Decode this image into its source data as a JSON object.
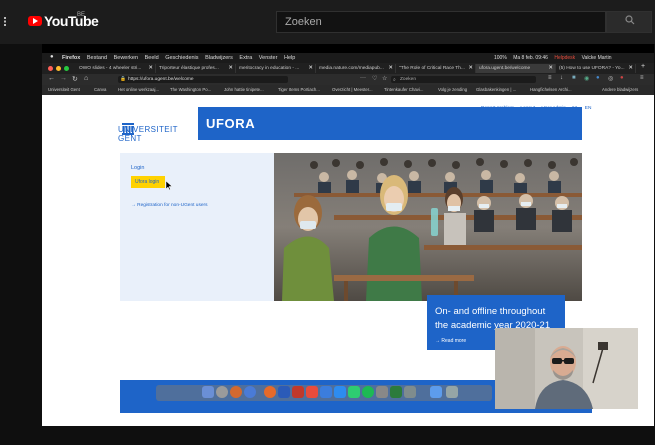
{
  "youtube": {
    "logo": "YouTube",
    "region": "BE",
    "search_placeholder": "Zoeken",
    "icons": [
      "menu-icon",
      "search-icon"
    ]
  },
  "mac_menubar": {
    "items": [
      "Firefox",
      "Bestand",
      "Bewerken",
      "Beeld",
      "Geschiedenis",
      "Bladwijzers",
      "Extra",
      "Venster",
      "Help"
    ],
    "battery": "100%",
    "datetime": "Ma 8 feb. 09:46",
    "support": "Helpdesk",
    "user": "Valcke Martin"
  },
  "tabs": [
    {
      "label": "OWO slides - 4 wheeler stri...",
      "active": false
    },
    {
      "label": "Triporteur élastique profes...",
      "active": false
    },
    {
      "label": "meritocracy in education - ...",
      "active": false
    },
    {
      "label": "media.nature.com/mediapub...",
      "active": false
    },
    {
      "label": "\"The Role of Critical Race Th...",
      "active": false
    },
    {
      "label": "ufora.ugent.be/welcome",
      "active": true
    },
    {
      "label": "(5) How to use UFORA? - Yo...",
      "active": false
    }
  ],
  "address_bar": {
    "url": "https://ufora.ugent.be/welcome",
    "search_placeholder": "Zoeken"
  },
  "bookmarks": [
    "Universiteit Gent",
    "Canva",
    "Het online werkzaaj...",
    "The Washington Po...",
    "John hattie tinipete...",
    "Tiger Items Portiach...",
    "Overzicht | Meester...",
    "Tintenkaufer Chavi...",
    "Volg je zending",
    "Glasbakenkingen | ...",
    "Hangfichelsen Archi...",
    "Andere bladwijzers"
  ],
  "ufora": {
    "top_links": [
      "Report problem",
      "Logout",
      "User admin",
      "NL",
      "EN"
    ],
    "university_line1": "UNIVERSITEIT",
    "university_line2": "GENT",
    "title": "UFORA",
    "login_label": "Login",
    "login_button": "Ufora login",
    "register_link": "Registration for non-UGent users",
    "headline_line1": "On- and offline throughout",
    "headline_line2": "the academic year 2020-21",
    "read_more": "Read more"
  },
  "colors": {
    "ugent_blue": "#1e64c8",
    "ugent_yellow": "#ffd200",
    "youtube_red": "#ff0000",
    "youtube_bg": "#1c1c1c"
  }
}
